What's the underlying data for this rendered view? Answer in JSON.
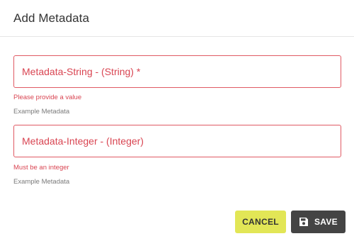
{
  "dialog": {
    "title": "Add Metadata"
  },
  "fields": [
    {
      "label": "Metadata-String - (String) *",
      "error": "Please provide a value",
      "helper": "Example Metadata"
    },
    {
      "label": "Metadata-Integer - (Integer)",
      "error": "Must be an integer",
      "helper": "Example Metadata"
    }
  ],
  "actions": {
    "cancel_label": "CANCEL",
    "save_label": "SAVE",
    "save_icon": "floppy-disk-icon"
  },
  "colors": {
    "error": "#d94552",
    "cancel_bg": "#e2e656",
    "save_bg": "#444444"
  }
}
